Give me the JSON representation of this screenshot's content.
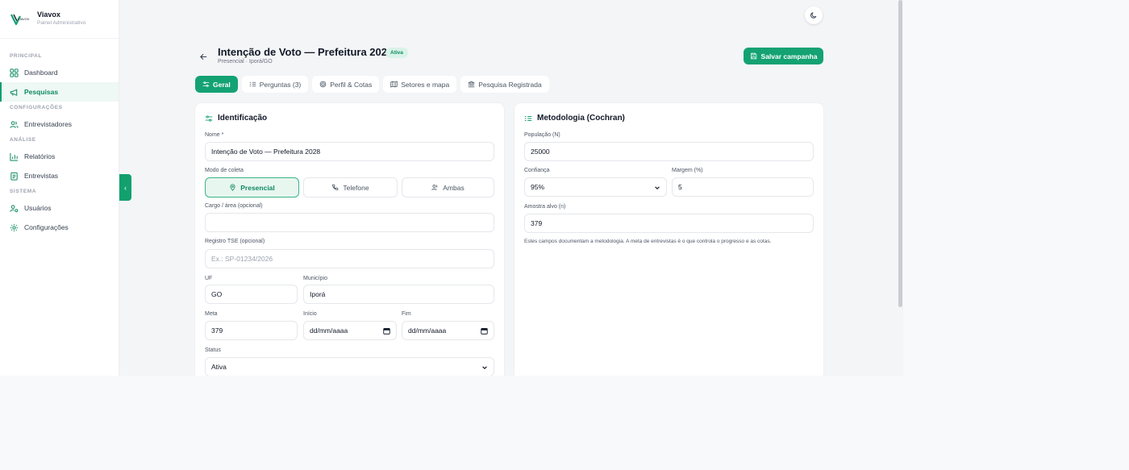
{
  "brand": {
    "name": "Viavox",
    "subtitle": "Painel Administrativo",
    "logo_text": "VIAVOX"
  },
  "sidebar": {
    "sections": [
      {
        "label": "PRINCIPAL",
        "items": [
          {
            "label": "Dashboard",
            "icon": "grid-icon"
          },
          {
            "label": "Pesquisas",
            "icon": "megaphone-icon",
            "active": true
          }
        ]
      },
      {
        "label": "CONFIGURAÇÕES",
        "items": [
          {
            "label": "Entrevistadores",
            "icon": "users-icon"
          }
        ]
      },
      {
        "label": "ANÁLISE",
        "items": [
          {
            "label": "Relatórios",
            "icon": "bar-chart-icon"
          },
          {
            "label": "Entrevistas",
            "icon": "clipboard-icon"
          }
        ]
      },
      {
        "label": "SISTEMA",
        "items": [
          {
            "label": "Usuários",
            "icon": "user-cog-icon"
          },
          {
            "label": "Configurações",
            "icon": "gear-icon"
          }
        ]
      }
    ],
    "collapse_glyph": "‹"
  },
  "header": {
    "title": "Intenção de Voto — Prefeitura 2028",
    "status": "Ativa",
    "subtitle": "Presencial · Iporá/GO",
    "save_label": "Salvar campanha"
  },
  "tabs": [
    {
      "label": "Geral",
      "active": true,
      "icon": "sliders-icon"
    },
    {
      "label": "Perguntas (3)",
      "icon": "list-icon"
    },
    {
      "label": "Perfil & Cotas",
      "icon": "target-icon"
    },
    {
      "label": "Setores e mapa",
      "icon": "map-icon"
    },
    {
      "label": "Pesquisa Registrada",
      "icon": "landmark-icon"
    }
  ],
  "identificacao": {
    "title": "Identificação",
    "nome_label": "Nome *",
    "nome_value": "Intenção de Voto — Prefeitura 2028",
    "modo_label": "Modo de coleta",
    "modos": [
      {
        "label": "Presencial",
        "active": true
      },
      {
        "label": "Telefone"
      },
      {
        "label": "Ambas"
      }
    ],
    "cargo_label": "Cargo / área (opcional)",
    "cargo_value": "",
    "tse_label": "Registro TSE (opcional)",
    "tse_placeholder": "Ex.: SP-01234/2026",
    "uf_label": "UF",
    "uf_value": "GO",
    "municipio_label": "Município",
    "municipio_value": "Iporá",
    "meta_label": "Meta",
    "meta_value": "379",
    "inicio_label": "Início",
    "inicio_value": "dd/mm/aaaa",
    "fim_label": "Fim",
    "fim_value": "dd/mm/aaaa",
    "status_label": "Status",
    "status_value": "Ativa"
  },
  "metodologia": {
    "title": "Metodologia (Cochran)",
    "populacao_label": "População (N)",
    "populacao_value": "25000",
    "confianca_label": "Confiança",
    "confianca_value": "95%",
    "margem_label": "Margem (%)",
    "margem_value": "5",
    "amostra_label": "Amostra alvo (n)",
    "amostra_value": "379",
    "note": "Estes campos documentam a metodologia. A meta de entrevistas é o que controla o progresso e as cotas."
  },
  "colors": {
    "accent": "#14a273",
    "accent_light": "#e8f6f0",
    "text": "#111827"
  }
}
